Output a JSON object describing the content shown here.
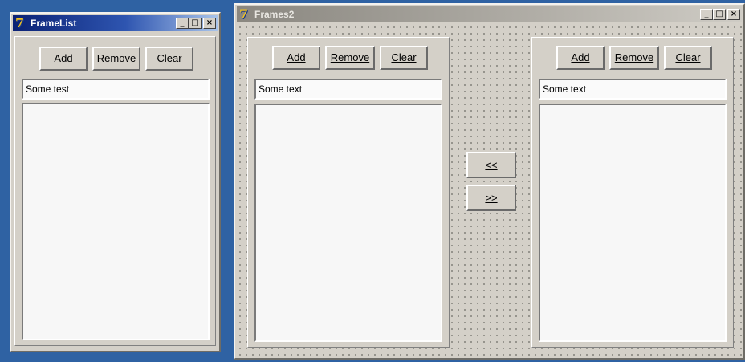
{
  "colors": {
    "desktop": "#2f62a3",
    "face": "#d4d0c8",
    "active_title": "#0b2275",
    "inactive_title": "#8a8780",
    "list_bg": "#f7f7f7"
  },
  "caption_buttons": {
    "minimize": "_",
    "maximize": "□",
    "close": "×"
  },
  "window_framelist": {
    "title": "FrameList",
    "icon": "delphi-icon",
    "frame": {
      "add_label": "Add",
      "remove_label": "Remove",
      "clear_label": "Clear",
      "edit_value": "Some test",
      "list_items": []
    }
  },
  "window_frames2": {
    "title": "Frames2",
    "icon": "delphi-icon",
    "left_frame": {
      "add_label": "Add",
      "remove_label": "Remove",
      "clear_label": "Clear",
      "edit_value": "Some text",
      "list_items": []
    },
    "move_left_label": "<<",
    "move_right_label": ">>",
    "right_frame": {
      "add_label": "Add",
      "remove_label": "Remove",
      "clear_label": "Clear",
      "edit_value": "Some text",
      "list_items": []
    }
  }
}
